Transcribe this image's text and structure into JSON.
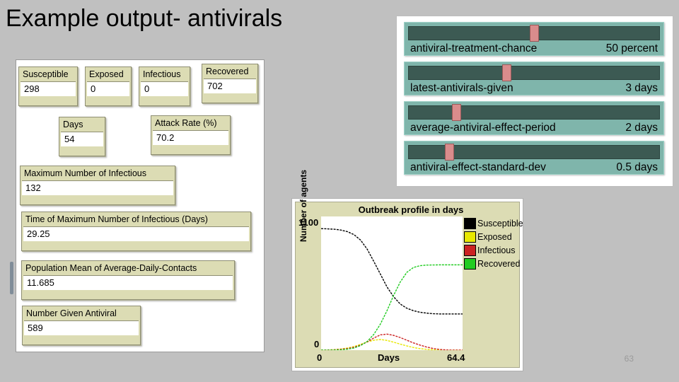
{
  "slide": {
    "title": "Example output- antivirals",
    "page_number": "63"
  },
  "monitors": [
    {
      "label": "Susceptible",
      "value": "298"
    },
    {
      "label": "Exposed",
      "value": "0"
    },
    {
      "label": "Infectious",
      "value": "0"
    },
    {
      "label": "Recovered",
      "value": "702"
    },
    {
      "label": "Days",
      "value": "54"
    },
    {
      "label": "Attack Rate (%)",
      "value": "70.2"
    },
    {
      "label": "Maximum Number of Infectious",
      "value": "132"
    },
    {
      "label": "Time of Maximum Number of Infectious (Days)",
      "value": "29.25"
    },
    {
      "label": "Population Mean of Average-Daily-Contacts",
      "value": "11.685"
    },
    {
      "label": "Number Given Antiviral",
      "value": "589"
    }
  ],
  "sliders": [
    {
      "name": "antiviral-treatment-chance",
      "value": "50 percent",
      "position_pct": 50
    },
    {
      "name": "latest-antivirals-given",
      "value": "3 days",
      "position_pct": 39
    },
    {
      "name": "average-antiviral-effect-period",
      "value": "2 days",
      "position_pct": 19
    },
    {
      "name": "antiviral-effect-standard-dev",
      "value": "0.5 days",
      "position_pct": 16
    }
  ],
  "chart_data": {
    "type": "line",
    "title": "Outbreak profile in days",
    "xlabel": "Days",
    "ylabel": "Number of agents",
    "xlim": [
      0,
      64.4
    ],
    "ylim": [
      0,
      1100
    ],
    "xticks": [
      "0",
      "64.4"
    ],
    "yticks": [
      "0",
      "1100"
    ],
    "grid": false,
    "legend_position": "right",
    "x": [
      0,
      3,
      6,
      9,
      12,
      15,
      18,
      21,
      24,
      27,
      30,
      33,
      36,
      39,
      42,
      45,
      48,
      51,
      54,
      57,
      60,
      64.4
    ],
    "series": [
      {
        "name": "Susceptible",
        "color": "#000000",
        "values": [
          1000,
          998,
          995,
          988,
          975,
          950,
          905,
          830,
          730,
          625,
          520,
          440,
          380,
          345,
          325,
          312,
          305,
          300,
          298,
          298,
          298,
          298
        ]
      },
      {
        "name": "Exposed",
        "color": "#e8e800",
        "values": [
          0,
          2,
          5,
          10,
          18,
          30,
          48,
          68,
          82,
          88,
          80,
          66,
          50,
          35,
          22,
          13,
          7,
          3,
          1,
          0,
          0,
          0
        ]
      },
      {
        "name": "Infectious",
        "color": "#cc2222",
        "values": [
          0,
          1,
          3,
          7,
          13,
          24,
          42,
          68,
          100,
          126,
          132,
          122,
          104,
          82,
          60,
          42,
          26,
          14,
          6,
          2,
          0,
          0
        ]
      },
      {
        "name": "Recovered",
        "color": "#22cc22",
        "values": [
          0,
          0,
          1,
          3,
          8,
          18,
          38,
          72,
          130,
          215,
          325,
          450,
          560,
          640,
          680,
          695,
          700,
          701,
          702,
          702,
          702,
          702
        ]
      }
    ]
  }
}
